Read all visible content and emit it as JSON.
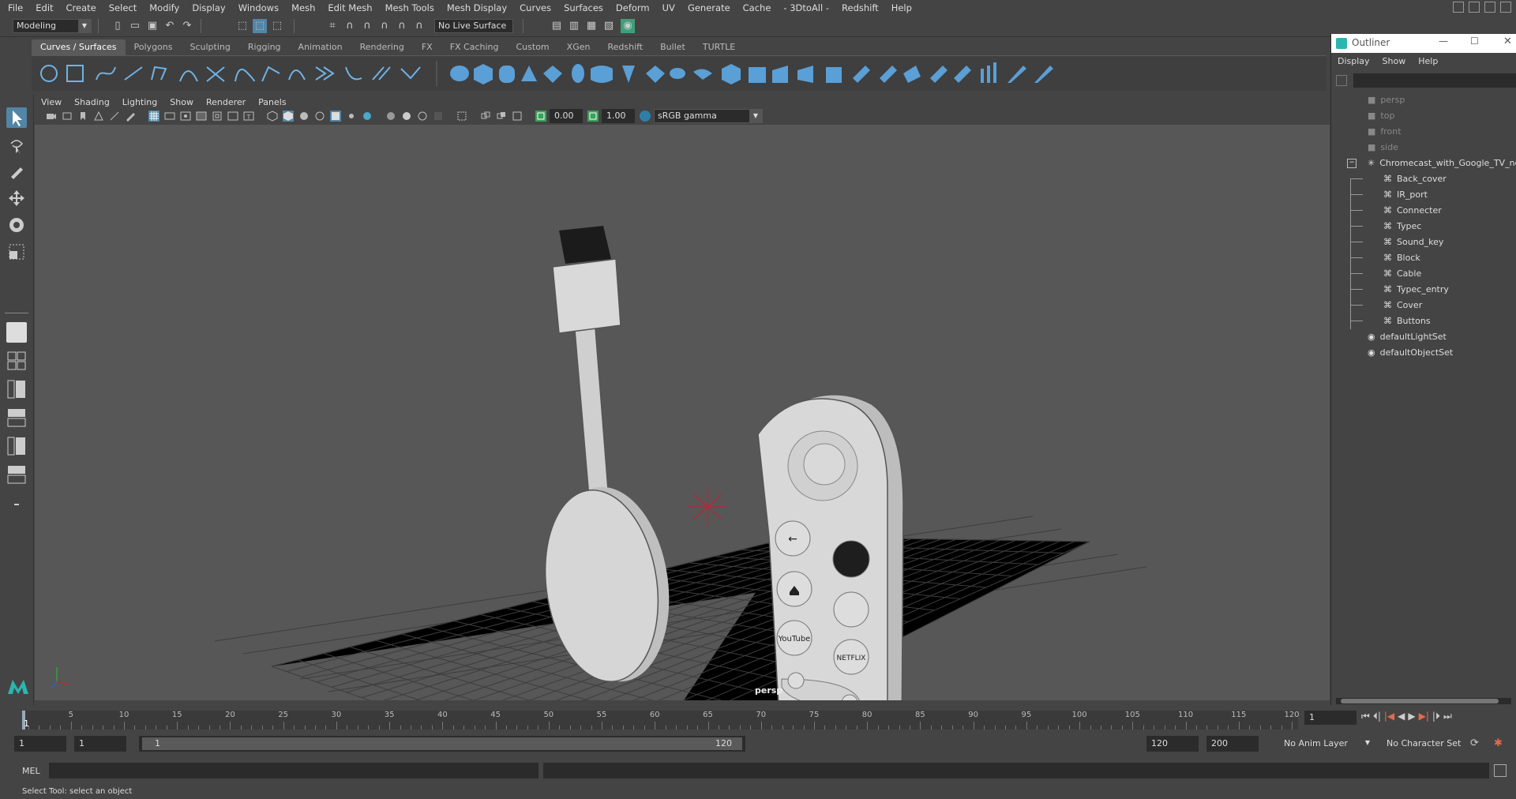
{
  "menubar": {
    "items": [
      "File",
      "Edit",
      "Create",
      "Select",
      "Modify",
      "Display",
      "Windows",
      "Mesh",
      "Edit Mesh",
      "Mesh Tools",
      "Mesh Display",
      "Curves",
      "Surfaces",
      "Deform",
      "UV",
      "Generate",
      "Cache",
      "- 3DtoAll -",
      "Redshift",
      "Help"
    ]
  },
  "statusline": {
    "mode": "Modeling",
    "live_surface": "No Live Surface"
  },
  "shelf": {
    "tabs": [
      "Curves / Surfaces",
      "Polygons",
      "Sculpting",
      "Rigging",
      "Animation",
      "Rendering",
      "FX",
      "FX Caching",
      "Custom",
      "XGen",
      "Redshift",
      "Bullet",
      "TURTLE"
    ],
    "active_tab": "Curves / Surfaces"
  },
  "viewport": {
    "menu": [
      "View",
      "Shading",
      "Lighting",
      "Show",
      "Renderer",
      "Panels"
    ],
    "exposure": "0.00",
    "gamma": "1.00",
    "color_space": "sRGB gamma",
    "camera_label": "persp"
  },
  "outliner": {
    "title": "Outliner",
    "menu": [
      "Display",
      "Show",
      "Help"
    ],
    "cameras": [
      "persp",
      "top",
      "front",
      "side"
    ],
    "root": "Chromecast_with_Google_TV_ncl",
    "children": [
      "Back_cover",
      "IR_port",
      "Connecter",
      "Typec",
      "Sound_key",
      "Block",
      "Cable",
      "Typec_entry",
      "Cover",
      "Buttons"
    ],
    "sets": [
      "defaultLightSet",
      "defaultObjectSet"
    ]
  },
  "timeline": {
    "ticks": [
      "5",
      "10",
      "15",
      "20",
      "25",
      "30",
      "35",
      "40",
      "45",
      "50",
      "55",
      "60",
      "65",
      "70",
      "75",
      "80",
      "85",
      "90",
      "95",
      "100",
      "105",
      "110",
      "115",
      "120"
    ],
    "start_marker": "1",
    "current_frame": "1"
  },
  "range": {
    "start": "1",
    "playback_start": "1",
    "slider_start": "1",
    "slider_end": "120",
    "playback_end": "120",
    "end": "200",
    "anim_layer": "No Anim Layer",
    "character_set": "No Character Set"
  },
  "cmdline": {
    "label": "MEL"
  },
  "helpline": {
    "text": "Select Tool: select an object"
  },
  "colors": {
    "accent": "#5285a6",
    "viewport_bg": "#575757",
    "ui_bg": "#444444"
  }
}
